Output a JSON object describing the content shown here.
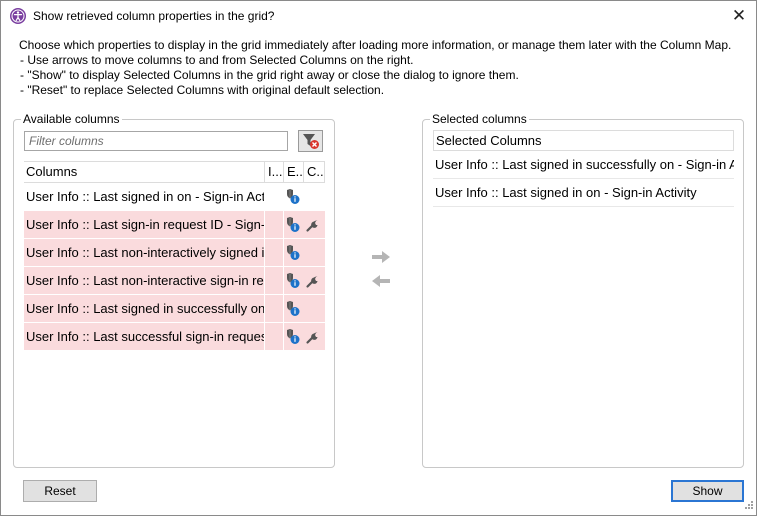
{
  "dialog": {
    "title": "Show retrieved column properties in the grid?",
    "close_glyph": "✕"
  },
  "instructions": {
    "intro": "Choose which properties to display in the grid immediately after loading more information, or manage them later with the Column Map.",
    "items": [
      "- Use arrows to move columns to and from Selected Columns on the right.",
      "- \"Show\" to display Selected Columns in the grid right away or close the dialog to ignore them.",
      "- \"Reset\" to replace Selected Columns with original default selection."
    ]
  },
  "available": {
    "legend": "Available columns",
    "filter_placeholder": "Filter columns",
    "filter_value": "",
    "headers": {
      "columns": "Columns",
      "i": "I...",
      "e": "E...",
      "c": "C..."
    },
    "rows": [
      {
        "name": "User Info :: Last signed in on - Sign-in Activity",
        "highlighted": false,
        "has_e_icon": true,
        "has_c_icon": false
      },
      {
        "name": "User Info :: Last sign-in request ID - Sign-in Activity",
        "highlighted": true,
        "has_e_icon": true,
        "has_c_icon": true
      },
      {
        "name": "User Info :: Last non-interactively signed in on - Sign-in Activity",
        "highlighted": true,
        "has_e_icon": true,
        "has_c_icon": false
      },
      {
        "name": "User Info :: Last non-interactive sign-in request ID - Sign-in Activity",
        "highlighted": true,
        "has_e_icon": true,
        "has_c_icon": true
      },
      {
        "name": "User Info :: Last signed in successfully on - Sign-in Activity",
        "highlighted": true,
        "has_e_icon": true,
        "has_c_icon": false
      },
      {
        "name": "User Info :: Last successful sign-in request ID - Sign-in Activity",
        "highlighted": true,
        "has_e_icon": true,
        "has_c_icon": true
      }
    ]
  },
  "selected": {
    "legend": "Selected columns",
    "header": "Selected Columns",
    "rows": [
      "User Info :: Last signed in successfully on - Sign-in Activity",
      "User Info :: Last signed in on - Sign-in Activity"
    ]
  },
  "buttons": {
    "reset": "Reset",
    "show": "Show"
  },
  "colors": {
    "highlight_row": "#fadbdd",
    "accent": "#2b76d3",
    "app_icon": "#7a3fa0",
    "info_blue": "#1d72c9",
    "filter_clear_red": "#d9342b"
  },
  "icons": {
    "app": "user-accessibility-icon",
    "filter_clear": "filter-clear-icon",
    "e_column": "shield-info-icon",
    "c_column": "wrench-icon",
    "move_right": "arrow-right-icon",
    "move_left": "arrow-left-icon"
  }
}
